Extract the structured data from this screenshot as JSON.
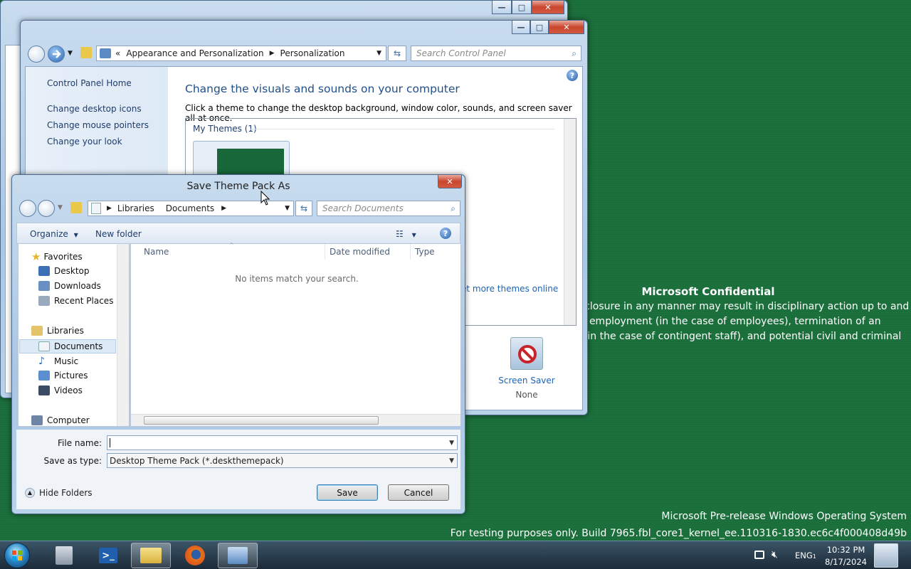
{
  "desktop": {
    "confidential_title": "Microsoft Confidential",
    "confidential_lines": [
      "isclosure in any manner may result in disciplinary action up to and",
      "of employment (in the case of employees), termination of an",
      "t (in the case of contingent staff), and potential civil and criminal"
    ],
    "prerelease_line1": "Microsoft Pre-release Windows Operating System",
    "prerelease_line2": "For testing purposes only. Build 7965.fbl_core1_kernel_ee.110316-1830.ec6c4f000408d49b"
  },
  "personalization": {
    "breadcrumb": [
      "Appearance and Personalization",
      "Personalization"
    ],
    "breadcrumb_prefix": "«",
    "search_placeholder": "Search Control Panel",
    "left_links": [
      "Control Panel Home",
      "Change desktop icons",
      "Change mouse pointers",
      "Change your look"
    ],
    "heading": "Change the visuals and sounds on your computer",
    "subheading": "Click a theme to change the desktop background, window color, sounds, and screen saver all at once.",
    "group_label": "My Themes (1)",
    "more_themes_link": "et more themes online",
    "screen_saver_label": "Screen Saver",
    "screen_saver_value": "None"
  },
  "dialog": {
    "title": "Save Theme Pack As",
    "address": [
      "Libraries",
      "Documents"
    ],
    "search_placeholder": "Search Documents",
    "organize_label": "Organize",
    "new_folder_label": "New folder",
    "nav": {
      "favorites": "Favorites",
      "desktop": "Desktop",
      "downloads": "Downloads",
      "recent": "Recent Places",
      "libraries": "Libraries",
      "documents": "Documents",
      "music": "Music",
      "pictures": "Pictures",
      "videos": "Videos",
      "computer": "Computer"
    },
    "columns": [
      "Name",
      "Date modified",
      "Type"
    ],
    "empty_message": "No items match your search.",
    "file_name_label": "File name:",
    "file_name_value": "",
    "save_type_label": "Save as type:",
    "save_type_value": "Desktop Theme Pack (*.deskthemepack)",
    "hide_folders_label": "Hide Folders",
    "save_label": "Save",
    "cancel_label": "Cancel"
  },
  "taskbar": {
    "language": "ENG",
    "time": "10:32 PM",
    "date": "8/17/2024"
  },
  "colors": {
    "desktop": "#1a6e3a",
    "link": "#1e63b4",
    "heading": "#1f4f8a"
  }
}
